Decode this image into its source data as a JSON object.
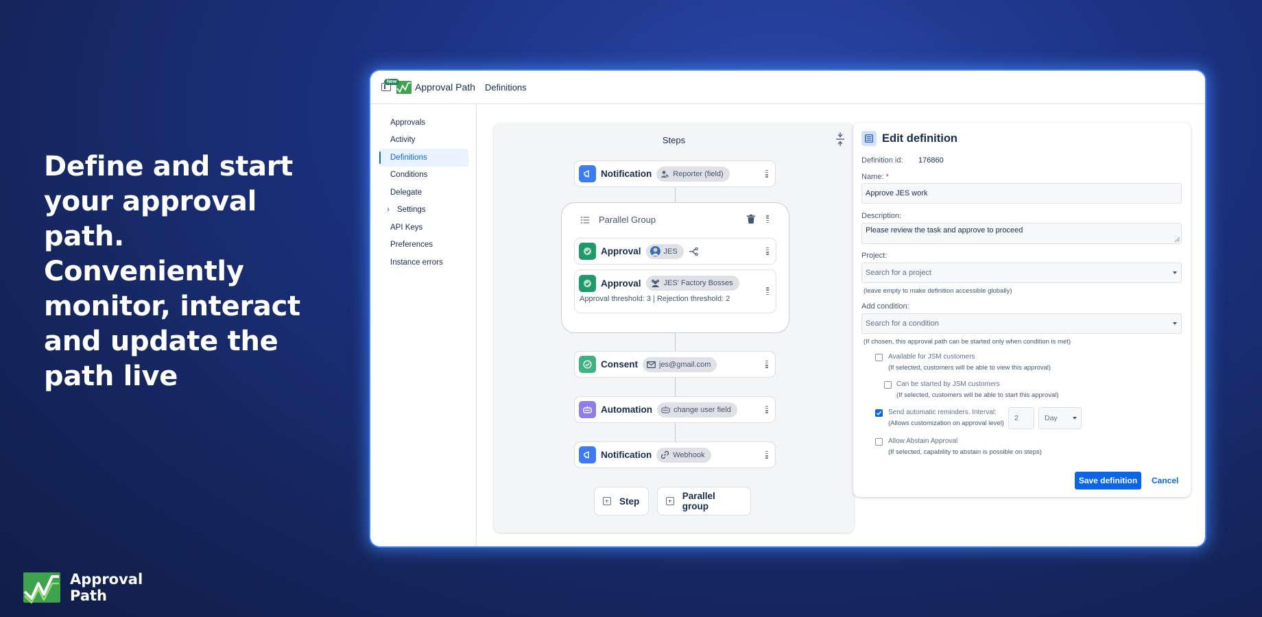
{
  "marketing": {
    "headline": "Define and start your approval path. Conveniently monitor, interact and update the path live",
    "brand_name": "Approval Path"
  },
  "colors": {
    "accent": "#0c66e4",
    "approval": "#1f9a6b",
    "notification": "#3d7bf5",
    "automation": "#8f7ee7",
    "glow": "#3d7bff"
  },
  "topbar": {
    "new_badge": "New",
    "app_name": "Approval Path",
    "breadcrumb": "Definitions"
  },
  "sidebar": {
    "items": [
      {
        "label": "Approvals"
      },
      {
        "label": "Activity"
      },
      {
        "label": "Definitions",
        "active": true
      },
      {
        "label": "Conditions"
      },
      {
        "label": "Delegate"
      },
      {
        "label": "Settings",
        "expandable": true
      },
      {
        "label": "API Keys"
      },
      {
        "label": "Preferences"
      },
      {
        "label": "Instance errors"
      }
    ]
  },
  "steps": {
    "title": "Steps",
    "notification1": {
      "name": "Notification",
      "chip": "Reporter (field)",
      "icon": "megaphone-icon"
    },
    "parallel_group": {
      "title": "Parallel Group",
      "approval1": {
        "name": "Approval",
        "chip": "JES",
        "icon": "shield-check-icon"
      },
      "approval2": {
        "name": "Approval",
        "chip": "JES' Factory Bosses",
        "threshold": "Approval threshold: 3 | Rejection threshold: 2"
      }
    },
    "consent": {
      "name": "Consent",
      "chip": "jes@gmail.com",
      "icon": "check-circle-icon"
    },
    "automation": {
      "name": "Automation",
      "chip": "change user field",
      "icon": "robot-icon"
    },
    "notification2": {
      "name": "Notification",
      "chip": "Webhook",
      "icon": "megaphone-icon"
    },
    "add_step": "Step",
    "add_parallel": "Parallel group"
  },
  "edit": {
    "title": "Edit definition",
    "definition_id_label": "Definition id:",
    "definition_id": "176860",
    "name_label": "Name:",
    "name_required": "*",
    "name_value": "Approve JES work",
    "description_label": "Description:",
    "description_value": "Please review the task and approve to proceed",
    "project_label": "Project:",
    "project_placeholder": "Search for a project",
    "project_hint": "(leave empty to make definition accessible globally)",
    "condition_label": "Add condition:",
    "condition_placeholder": "Search for a condition",
    "condition_hint": "(If chosen, this approval path can be started only when condition is met)",
    "jsm_view_label": "Available for JSM customers",
    "jsm_view_hint": "(If selected, customers will be able to view this approval)",
    "jsm_view_checked": false,
    "jsm_start_label": "Can be started by JSM customers",
    "jsm_start_hint": "(If selected, customers will be able to start this approval)",
    "jsm_start_checked": false,
    "reminder_label": "Send automatic reminders. Interval:",
    "reminder_hint": "(Allows customization on approval level)",
    "reminder_checked": true,
    "reminder_interval": "2",
    "reminder_unit": "Day",
    "abstain_label": "Allow Abstain Approval",
    "abstain_hint": "(If selected, capability to abstain is possible on steps)",
    "abstain_checked": false,
    "save_label": "Save definition",
    "cancel_label": "Cancel"
  }
}
